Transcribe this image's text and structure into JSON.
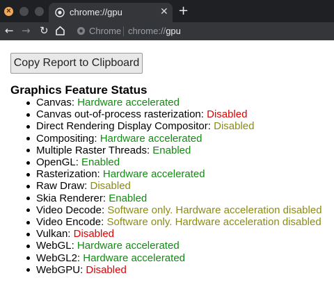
{
  "browser": {
    "tab": {
      "title": "chrome://gpu",
      "favicon": "globe-icon"
    },
    "toolbar": {
      "omnibox_chip": "Chrome",
      "url_scheme": "chrome://",
      "url_host": "gpu"
    }
  },
  "page": {
    "copy_button_label": "Copy Report to Clipboard",
    "section_title": "Graphics Feature Status",
    "features": [
      {
        "name": "Canvas: ",
        "status": "Hardware accelerated",
        "status_color": "green"
      },
      {
        "name": "Canvas out-of-process rasterization: ",
        "status": "Disabled",
        "status_color": "red"
      },
      {
        "name": "Direct Rendering Display Compositor: ",
        "status": "Disabled",
        "status_color": "olive"
      },
      {
        "name": "Compositing: ",
        "status": "Hardware accelerated",
        "status_color": "green"
      },
      {
        "name": "Multiple Raster Threads: ",
        "status": "Enabled",
        "status_color": "green"
      },
      {
        "name": "OpenGL: ",
        "status": "Enabled",
        "status_color": "green"
      },
      {
        "name": "Rasterization: ",
        "status": "Hardware accelerated",
        "status_color": "green"
      },
      {
        "name": "Raw Draw: ",
        "status": "Disabled",
        "status_color": "olive"
      },
      {
        "name": "Skia Renderer: ",
        "status": "Enabled",
        "status_color": "green"
      },
      {
        "name": "Video Decode: ",
        "status": "Software only. Hardware acceleration disabled",
        "status_color": "olive"
      },
      {
        "name": "Video Encode: ",
        "status": "Software only. Hardware acceleration disabled",
        "status_color": "olive"
      },
      {
        "name": "Vulkan: ",
        "status": "Disabled",
        "status_color": "red"
      },
      {
        "name": "WebGL: ",
        "status": "Hardware accelerated",
        "status_color": "green"
      },
      {
        "name": "WebGL2: ",
        "status": "Hardware accelerated",
        "status_color": "green"
      },
      {
        "name": "WebGPU: ",
        "status": "Disabled",
        "status_color": "red"
      }
    ]
  },
  "colors": {
    "green": "#138a13",
    "red": "#e00000",
    "olive": "#8b8b14",
    "chrome_dark": "#1f2023",
    "chrome_toolbar": "#35363a"
  }
}
